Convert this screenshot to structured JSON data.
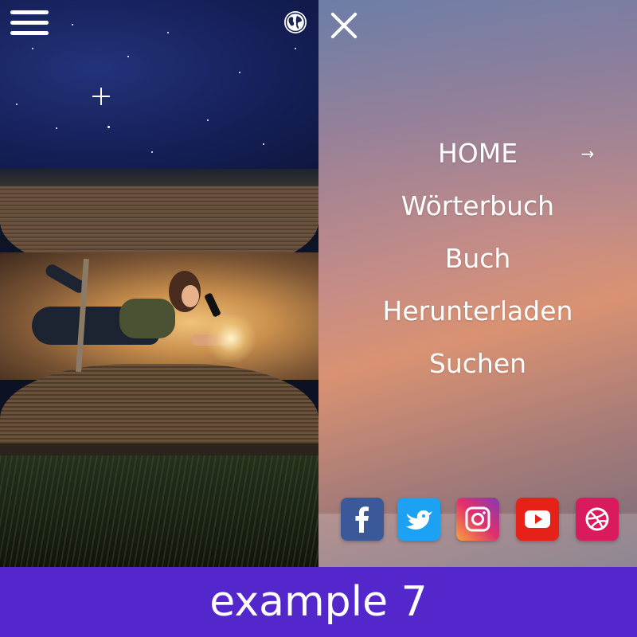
{
  "header": {
    "menu_icon": "hamburger-menu-icon",
    "language_icon": "globe-icon",
    "close_icon": "close-icon"
  },
  "nav": {
    "items": [
      {
        "label": "HOME",
        "active": true,
        "icon": "arrow-right-icon"
      },
      {
        "label": "Wörterbuch"
      },
      {
        "label": "Buch"
      },
      {
        "label": "Herunterladen"
      },
      {
        "label": "Suchen"
      }
    ]
  },
  "social": [
    {
      "name": "facebook-icon",
      "color": "#3b5998"
    },
    {
      "name": "twitter-icon",
      "color": "#1da1f2"
    },
    {
      "name": "instagram-icon",
      "color": "#e1306c"
    },
    {
      "name": "youtube-icon",
      "color": "#e62117"
    },
    {
      "name": "dribbble-icon",
      "color": "#d91a5d"
    }
  ],
  "colors": {
    "footer_bg": "#5427cc",
    "text": "#ffffff"
  },
  "footer": {
    "label": "example 7"
  }
}
